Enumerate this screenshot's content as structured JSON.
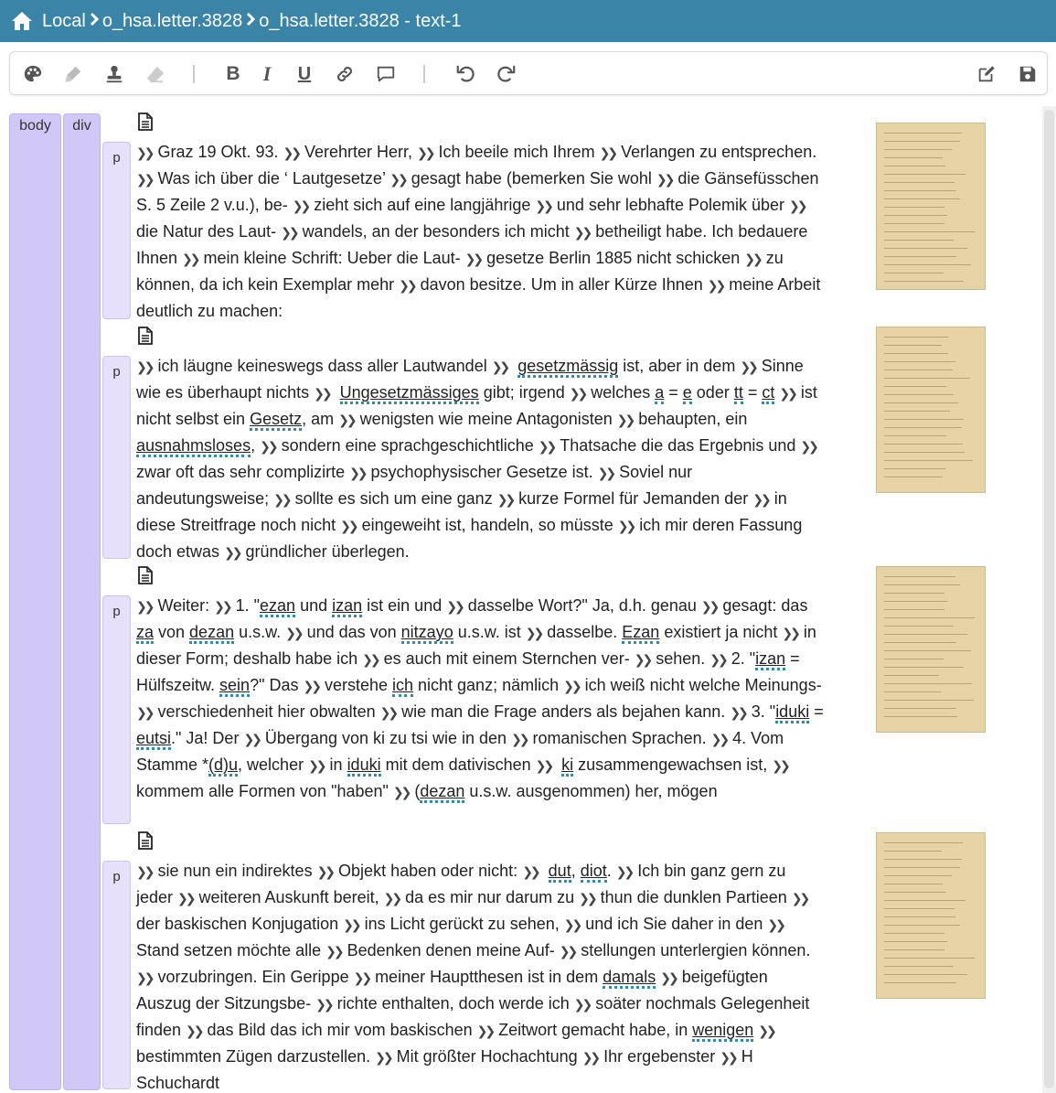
{
  "header": {
    "breadcrumbs": [
      "Local",
      "o_hsa.letter.3828",
      "o_hsa.letter.3828 - text-1"
    ],
    "background": "#3a84a8",
    "home_icon": "home-icon"
  },
  "toolbar": {
    "buttons": [
      {
        "name": "palette",
        "icon": "palette-icon"
      },
      {
        "name": "highlighter",
        "icon": "highlighter-icon"
      },
      {
        "name": "stamp",
        "icon": "stamp-icon"
      },
      {
        "name": "eraser",
        "icon": "eraser-icon"
      },
      {
        "name": "bold",
        "label": "B"
      },
      {
        "name": "italic",
        "label": "I"
      },
      {
        "name": "underline",
        "label": "U"
      },
      {
        "name": "link",
        "icon": "link-icon"
      },
      {
        "name": "comment",
        "icon": "comment-icon"
      },
      {
        "name": "undo",
        "icon": "undo-icon"
      },
      {
        "name": "redo",
        "icon": "redo-icon"
      },
      {
        "name": "edit",
        "icon": "edit-icon"
      },
      {
        "name": "save",
        "icon": "save-icon"
      }
    ]
  },
  "structure": {
    "body_label": "body",
    "div_label": "div",
    "p_label": "p",
    "element_color": "#d2c8f7"
  },
  "paragraphs": [
    {
      "segments": [
        {
          "lb": true,
          "t": "Graz 19 Okt. 93. "
        },
        {
          "lb": true,
          "t": "Verehrter Herr, "
        },
        {
          "lb": true,
          "t": "Ich beeile mich Ihrem "
        },
        {
          "lb": true,
          "t": "Verlangen zu entsprechen. "
        },
        {
          "lb": true,
          "t": "Was ich über die ‘ Lautgesetze’ "
        },
        {
          "lb": true,
          "t": "gesagt habe (bemerken Sie wohl "
        },
        {
          "lb": true,
          "t": "die Gänsefüsschen S. 5 Zeile 2 v.u.), be- "
        },
        {
          "lb": true,
          "t": "zieht sich auf eine langjährige "
        },
        {
          "lb": true,
          "t": "und sehr lebhafte Polemik über "
        },
        {
          "lb": true,
          "t": "die Natur des Laut- "
        },
        {
          "lb": true,
          "t": "wandels, an der besonders ich micht "
        },
        {
          "lb": true,
          "t": "betheiligt habe. Ich bedauere Ihnen "
        },
        {
          "lb": true,
          "t": "mein kleine Schrift: Ueber die Laut- "
        },
        {
          "lb": true,
          "t": "gesetze Berlin 1885 nicht schicken "
        },
        {
          "lb": true,
          "t": "zu können, da ich kein Exemplar mehr "
        },
        {
          "lb": true,
          "t": "davon besitze. Um in aller Kürze Ihnen "
        },
        {
          "lb": true,
          "t": "meine Arbeit deutlich zu machen:"
        }
      ]
    },
    {
      "segments": [
        {
          "lb": true,
          "t": "ich läugne keineswegs dass aller Lautwandel "
        },
        {
          "lb": true,
          "t": " "
        },
        {
          "u": "gesetzmässig"
        },
        {
          "t": " ist, aber in dem "
        },
        {
          "lb": true,
          "t": "Sinne wie es überhaupt nichts "
        },
        {
          "lb": true,
          "t": " "
        },
        {
          "u": "Ungesetzmässiges"
        },
        {
          "t": " gibt; irgend "
        },
        {
          "lb": true,
          "t": "welches "
        },
        {
          "u": "a"
        },
        {
          "t": " = "
        },
        {
          "u": "e"
        },
        {
          "t": " oder "
        },
        {
          "u": "tt"
        },
        {
          "t": " = "
        },
        {
          "u": "ct"
        },
        {
          "t": " "
        },
        {
          "lb": true,
          "t": "ist nicht selbst ein "
        },
        {
          "u": "Gesetz"
        },
        {
          "t": ", am "
        },
        {
          "lb": true,
          "t": "wenigsten wie meine Antagonisten "
        },
        {
          "lb": true,
          "t": "behaupten, ein "
        },
        {
          "u": "ausnahmsloses"
        },
        {
          "t": ", "
        },
        {
          "lb": true,
          "t": "sondern eine sprachgeschichtliche "
        },
        {
          "lb": true,
          "t": "Thatsache die das Ergebnis und "
        },
        {
          "lb": true,
          "t": "zwar oft das sehr complizirte "
        },
        {
          "lb": true,
          "t": "psychophysischer Gesetze ist. "
        },
        {
          "lb": true,
          "t": "Soviel nur andeutungsweise; "
        },
        {
          "lb": true,
          "t": "sollte es sich um eine ganz "
        },
        {
          "lb": true,
          "t": "kurze Formel für Jemanden der "
        },
        {
          "lb": true,
          "t": "in diese Streitfrage noch nicht "
        },
        {
          "lb": true,
          "t": "eingeweiht ist, handeln, so müsste "
        },
        {
          "lb": true,
          "t": "ich mir deren Fassung doch etwas "
        },
        {
          "lb": true,
          "t": "gründlicher überlegen."
        }
      ]
    },
    {
      "segments": [
        {
          "lb": true,
          "t": "Weiter: "
        },
        {
          "lb": true,
          "t": "1. \""
        },
        {
          "u": "ezan"
        },
        {
          "t": " und "
        },
        {
          "u": "izan"
        },
        {
          "t": " ist ein und "
        },
        {
          "lb": true,
          "t": "dasselbe Wort?\" Ja, d.h. genau "
        },
        {
          "lb": true,
          "t": "gesagt: das "
        },
        {
          "u": "za"
        },
        {
          "t": " von "
        },
        {
          "u": "dezan"
        },
        {
          "t": " u.s.w. "
        },
        {
          "lb": true,
          "t": "und das von "
        },
        {
          "u": "nitzayo"
        },
        {
          "t": " u.s.w. ist "
        },
        {
          "lb": true,
          "t": "dasselbe. "
        },
        {
          "u": "Ezan"
        },
        {
          "t": " existiert ja nicht "
        },
        {
          "lb": true,
          "t": "in dieser Form; deshalb habe ich "
        },
        {
          "lb": true,
          "t": "es auch mit einem Sternchen ver- "
        },
        {
          "lb": true,
          "t": "sehen. "
        },
        {
          "lb": true,
          "t": "2. \""
        },
        {
          "u": "izan"
        },
        {
          "t": " = Hülfszeitw. "
        },
        {
          "u": "sein"
        },
        {
          "t": "?\" Das "
        },
        {
          "lb": true,
          "t": "verstehe "
        },
        {
          "u": "ich"
        },
        {
          "t": " nicht ganz; nämlich "
        },
        {
          "lb": true,
          "t": "ich weiß nicht welche Meinungs- "
        },
        {
          "lb": true,
          "t": "verschiedenheit hier obwalten "
        },
        {
          "lb": true,
          "t": "wie man die Frage anders als bejahen kann. "
        },
        {
          "lb": true,
          "t": "3. \""
        },
        {
          "u": "iduki"
        },
        {
          "t": " = "
        },
        {
          "u": "eutsi"
        },
        {
          "t": ".\" Ja! Der "
        },
        {
          "lb": true,
          "t": "Übergang von ki zu tsi wie in den "
        },
        {
          "lb": true,
          "t": "romanischen Sprachen. "
        },
        {
          "lb": true,
          "t": "4. Vom Stamme *"
        },
        {
          "u": "(d)u"
        },
        {
          "t": ", welcher "
        },
        {
          "lb": true,
          "t": "in "
        },
        {
          "u": "iduki"
        },
        {
          "t": " mit dem dativischen "
        },
        {
          "lb": true,
          "t": " "
        },
        {
          "u": "ki"
        },
        {
          "t": " zusammengewachsen ist, "
        },
        {
          "lb": true,
          "t": "kommem alle Formen von \"haben\" "
        },
        {
          "lb": true,
          "t": "("
        },
        {
          "u": "dezan"
        },
        {
          "t": " u.s.w. ausgenommen) her, mögen"
        }
      ]
    },
    {
      "segments": [
        {
          "lb": true,
          "t": "sie nun ein indirektes "
        },
        {
          "lb": true,
          "t": "Objekt haben oder nicht: "
        },
        {
          "lb": true,
          "t": " "
        },
        {
          "u": "dut"
        },
        {
          "t": ", "
        },
        {
          "u": "diot"
        },
        {
          "t": ". "
        },
        {
          "lb": true,
          "t": "Ich bin ganz gern zu jeder "
        },
        {
          "lb": true,
          "t": "weiteren Auskunft bereit, "
        },
        {
          "lb": true,
          "t": "da es mir nur darum zu "
        },
        {
          "lb": true,
          "t": "thun die dunklen Partieen "
        },
        {
          "lb": true,
          "t": "der baskischen Konjugation "
        },
        {
          "lb": true,
          "t": "ins Licht gerückt zu sehen, "
        },
        {
          "lb": true,
          "t": "und ich Sie daher in den "
        },
        {
          "lb": true,
          "t": "Stand setzen möchte alle "
        },
        {
          "lb": true,
          "t": "Bedenken denen meine Auf- "
        },
        {
          "lb": true,
          "t": "stellungen unterlergien können. "
        },
        {
          "lb": true,
          "t": "vorzubringen. Ein Gerippe "
        },
        {
          "lb": true,
          "t": "meiner Hauptthesen ist in dem "
        },
        {
          "u": "damals"
        },
        {
          "t": " "
        },
        {
          "lb": true,
          "t": "beigefügten Auszug der Sitzungsbe- "
        },
        {
          "lb": true,
          "t": "richte enthalten, doch werde ich "
        },
        {
          "lb": true,
          "t": "soäter nochmals Gelegenheit finden "
        },
        {
          "lb": true,
          "t": "das Bild das ich mir vom baskischen "
        },
        {
          "lb": true,
          "t": "Zeitwort gemacht habe, in "
        },
        {
          "u": "wenigen"
        },
        {
          "t": " "
        },
        {
          "lb": true,
          "t": "bestimmten Zügen darzustellen. "
        },
        {
          "lb": true,
          "t": "Mit größter Hochachtung "
        },
        {
          "lb": true,
          "t": "Ihr ergebenster "
        },
        {
          "lb": true,
          "t": "H Schuchardt"
        }
      ]
    }
  ],
  "facsimiles": [
    {
      "name": "page-1"
    },
    {
      "name": "page-2"
    },
    {
      "name": "page-3"
    },
    {
      "name": "page-4"
    }
  ]
}
